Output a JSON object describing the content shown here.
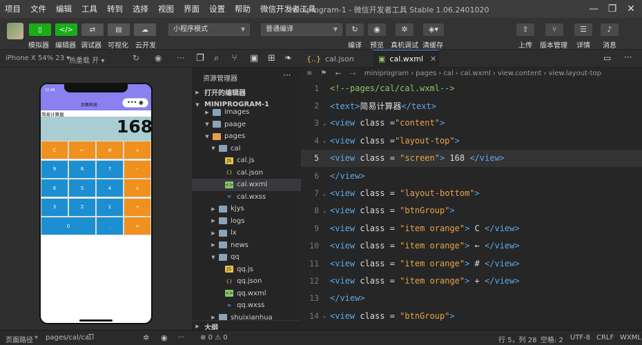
{
  "menu": [
    "项目",
    "文件",
    "编辑",
    "工具",
    "转到",
    "选择",
    "视图",
    "界面",
    "设置",
    "帮助",
    "微信开发者工具"
  ],
  "window_title": "miniprogram-1 - 微信开发者工具 Stable 1.06.2401020",
  "toolbar": {
    "simulator_label": "模拟器",
    "editor_label": "编辑器",
    "debugger_label": "调试器",
    "visual_label": "可视化",
    "cloud_label": "云开发",
    "mode_select": "小程序模式",
    "compile_select": "普通编译",
    "compile_label": "编译",
    "preview_label": "预览",
    "realdevice_label": "真机调试",
    "clearcache_label": "清缓存",
    "upload_label": "上传",
    "version_label": "版本管理",
    "details_label": "详情",
    "messages_label": "消息"
  },
  "simbar": {
    "device": "iPhone X 54% 23 ▾",
    "hot_reload": "热重载 开 ▾"
  },
  "phone": {
    "time": "22:48",
    "nav_title": "页面布局",
    "page_label": "简易计算器",
    "screen_value": "168",
    "keys": [
      "C",
      "←",
      "#",
      "+",
      "9",
      "8",
      "7",
      "-",
      "6",
      "5",
      "4",
      "×",
      "3",
      "2",
      "1",
      "÷",
      "0",
      ".",
      "="
    ]
  },
  "explorer": {
    "title": "资源管理器",
    "open_editors": "打开的编辑器",
    "project": "MINIPROGRAM-1",
    "items": [
      {
        "name": "images",
        "depth": 2,
        "type": "folder",
        "open": false
      },
      {
        "name": "paage",
        "depth": 2,
        "type": "folder",
        "open": true
      },
      {
        "name": "pages",
        "depth": 2,
        "type": "folder-o",
        "open": true
      },
      {
        "name": "cal",
        "depth": 3,
        "type": "folder",
        "open": true
      },
      {
        "name": "cal.js",
        "depth": 4,
        "type": "js"
      },
      {
        "name": "cal.json",
        "depth": 4,
        "type": "json"
      },
      {
        "name": "cal.wxml",
        "depth": 4,
        "type": "wxml",
        "selected": true
      },
      {
        "name": "cal.wxss",
        "depth": 4,
        "type": "wxss"
      },
      {
        "name": "kjys",
        "depth": 3,
        "type": "folder",
        "open": false
      },
      {
        "name": "logs",
        "depth": 3,
        "type": "folder",
        "open": false
      },
      {
        "name": "lx",
        "depth": 3,
        "type": "folder",
        "open": false
      },
      {
        "name": "news",
        "depth": 3,
        "type": "folder",
        "open": false
      },
      {
        "name": "qq",
        "depth": 3,
        "type": "folder",
        "open": true
      },
      {
        "name": "qq.js",
        "depth": 4,
        "type": "js"
      },
      {
        "name": "qq.json",
        "depth": 4,
        "type": "json"
      },
      {
        "name": "qq.wxml",
        "depth": 4,
        "type": "wxml"
      },
      {
        "name": "qq.wxss",
        "depth": 4,
        "type": "wxss"
      },
      {
        "name": "shuixianhua",
        "depth": 3,
        "type": "folder",
        "open": false
      }
    ],
    "outline": "大纲"
  },
  "tabs": [
    {
      "label": "cal.json",
      "active": false
    },
    {
      "label": "cal.wxml",
      "active": true
    }
  ],
  "breadcrumb": [
    "miniprogram",
    "pages",
    "cal",
    "cal.wxml",
    "view.content",
    "view.layout-top"
  ],
  "code_lines": [
    {
      "n": "1",
      "html": "<span class='cm'>&lt;!--pages/cal/cal.wxml--&gt;</span>"
    },
    {
      "n": "2",
      "html": "<span class='tg'>&lt;text&gt;</span>简易计算器<span class='tg'>&lt;/text&gt;</span>"
    },
    {
      "n": "3",
      "fold": true,
      "html": "<span class='tg'>&lt;view</span> <span class='at'>class</span> =<span class='st'>\"content\"</span><span class='tg'>&gt;</span>"
    },
    {
      "n": "4",
      "fold": true,
      "html": "<span class='tg'>&lt;view</span> <span class='at'>class</span> =<span class='st'>\"layout-top\"</span><span class='tg'>&gt;</span>"
    },
    {
      "n": "5",
      "hl": true,
      "html": "<span class='tg'>&lt;view</span> <span class='at'>class</span> = <span class='st'>\"screen\"</span><span class='tg'>&gt;</span> 168 <span class='tg'>&lt;/view&gt;</span>"
    },
    {
      "n": "6",
      "html": "<span class='tg'>&lt;/view&gt;</span>"
    },
    {
      "n": "7",
      "fold": true,
      "html": "<span class='tg'>&lt;view</span> <span class='at'>class</span> = <span class='st'>\"layout-bottom\"</span><span class='tg'>&gt;</span>"
    },
    {
      "n": "8",
      "fold": true,
      "html": "<span class='tg'>&lt;view</span> <span class='at'>class</span> = <span class='st'>\"btnGroup\"</span><span class='tg'>&gt;</span>"
    },
    {
      "n": "9",
      "html": "<span class='tg'>&lt;view</span> <span class='at'>class</span> = <span class='st'>\"item orange\"</span><span class='tg'>&gt;</span> C <span class='tg'>&lt;/view&gt;</span>"
    },
    {
      "n": "10",
      "html": "<span class='tg'>&lt;view</span> <span class='at'>class</span> = <span class='st'>\"item orange\"</span><span class='tg'>&gt;</span> ← <span class='tg'>&lt;/view&gt;</span>"
    },
    {
      "n": "11",
      "html": "<span class='tg'>&lt;view</span> <span class='at'>class</span> = <span class='st'>\"item orange\"</span><span class='tg'>&gt;</span> # <span class='tg'>&lt;/view&gt;</span>"
    },
    {
      "n": "12",
      "html": "<span class='tg'>&lt;view</span> <span class='at'>class</span> = <span class='st'>\"item orange\"</span><span class='tg'>&gt;</span> + <span class='tg'>&lt;/view&gt;</span>"
    },
    {
      "n": "13",
      "html": "<span class='tg'>&lt;/view&gt;</span>"
    },
    {
      "n": "14",
      "fold": true,
      "html": "<span class='tg'>&lt;view</span> <span class='at'>class</span> = <span class='st'>\"btnGroup\"</span><span class='tg'>&gt;</span>"
    }
  ],
  "status": {
    "page_path_label": "页面路径",
    "page_path": "pages/cal/cal",
    "problems": "⊗ 0 ⚠ 0",
    "cursor": "行 5，列 28",
    "spaces": "空格: 2",
    "encoding": "UTF-8",
    "eol": "CRLF",
    "lang": "WXML"
  }
}
